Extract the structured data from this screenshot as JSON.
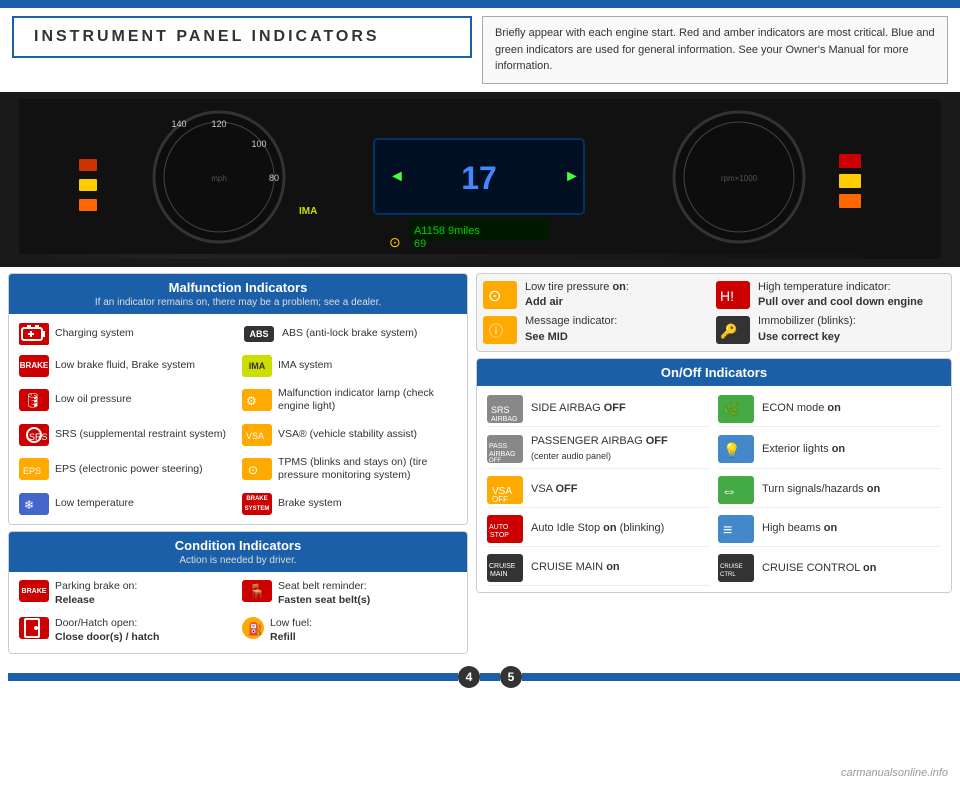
{
  "topBar": {},
  "header": {
    "title": "INSTRUMENT PANEL INDICATORS",
    "info": "Briefly appear with each engine start. Red and amber indicators are most critical. Blue and green indicators are used for general information. See your Owner's Manual for more information."
  },
  "malfunctionPanel": {
    "title": "Malfunction Indicators",
    "subtitle": "If an indicator remains on, there may be a problem; see a dealer.",
    "left_items": [
      {
        "label": "Charging system",
        "icon": "battery"
      },
      {
        "label": "Low brake fluid, Brake system",
        "icon": "brake"
      },
      {
        "label": "Low oil pressure",
        "icon": "oil"
      },
      {
        "label": "SRS (supplemental restraint system)",
        "icon": "airbag"
      },
      {
        "label": "EPS (electronic power steering)",
        "icon": "eps"
      },
      {
        "label": "Low temperature",
        "icon": "temp-low"
      }
    ],
    "right_items": [
      {
        "label": "ABS (anti-lock brake system)",
        "icon": "abs"
      },
      {
        "label": "IMA system",
        "icon": "ima"
      },
      {
        "label": "Malfunction indicator lamp (check engine light)",
        "icon": "engine"
      },
      {
        "label": "VSA® (vehicle stability assist)",
        "icon": "vsa"
      },
      {
        "label": "TPMS (blinks and stays on) (tire pressure monitoring system)",
        "icon": "tpms"
      },
      {
        "label": "Brake system",
        "icon": "brake-system"
      }
    ]
  },
  "conditionPanel": {
    "title": "Condition Indicators",
    "subtitle": "Action is needed by driver.",
    "items": [
      {
        "label": "Parking brake on:",
        "sublabel": "Release",
        "icon": "parking-brake"
      },
      {
        "label": "Door/Hatch open:",
        "sublabel": "Close door(s) / hatch",
        "icon": "door"
      },
      {
        "label": "Seat belt reminder:",
        "sublabel": "Fasten seat belt(s)",
        "icon": "seatbelt"
      },
      {
        "label": "Low fuel:",
        "sublabel": "Refill",
        "icon": "fuel"
      }
    ]
  },
  "topRightPanel": {
    "items": [
      {
        "label": "Low tire pressure ",
        "bold": "on",
        "sublabel": "Add air",
        "icon": "tire"
      },
      {
        "label": "High temperature indicator: ",
        "bold": "Pull over and cool down engine",
        "icon": "high-temp"
      },
      {
        "label": "Message indicator: ",
        "bold": "See MID",
        "icon": "message"
      },
      {
        "label": "Immobilizer (blinks):",
        "bold": "Use correct key",
        "icon": "immobilizer"
      }
    ]
  },
  "onOffPanel": {
    "title": "On/Off Indicators",
    "items": [
      {
        "label": "SIDE AIRBAG ",
        "bold": "OFF",
        "icon": "side-airbag"
      },
      {
        "label": "ECON mode ",
        "bold": "on",
        "icon": "econ"
      },
      {
        "label": "PASSENGER AIRBAG ",
        "bold": "OFF",
        "sublabel": "(center audio panel)",
        "icon": "pass-airbag"
      },
      {
        "label": "Exterior lights ",
        "bold": "on",
        "icon": "ext-lights"
      },
      {
        "label": "VSA ",
        "bold": "OFF",
        "icon": "vsa-off"
      },
      {
        "label": "Turn signals/hazards ",
        "bold": "on",
        "icon": "hazards"
      },
      {
        "label": "Auto Idle Stop ",
        "bold": "on",
        "sublabel": "(blinking)",
        "icon": "auto-idle"
      },
      {
        "label": "High beams ",
        "bold": "on",
        "icon": "high-beams"
      },
      {
        "label": "CRUISE MAIN ",
        "bold": "on",
        "icon": "cruise-main"
      },
      {
        "label": "CRUISE CONTROL ",
        "bold": "on",
        "icon": "cruise-control"
      }
    ]
  },
  "pages": {
    "left": "4",
    "right": "5"
  },
  "watermark": "carmanualsonline.info"
}
